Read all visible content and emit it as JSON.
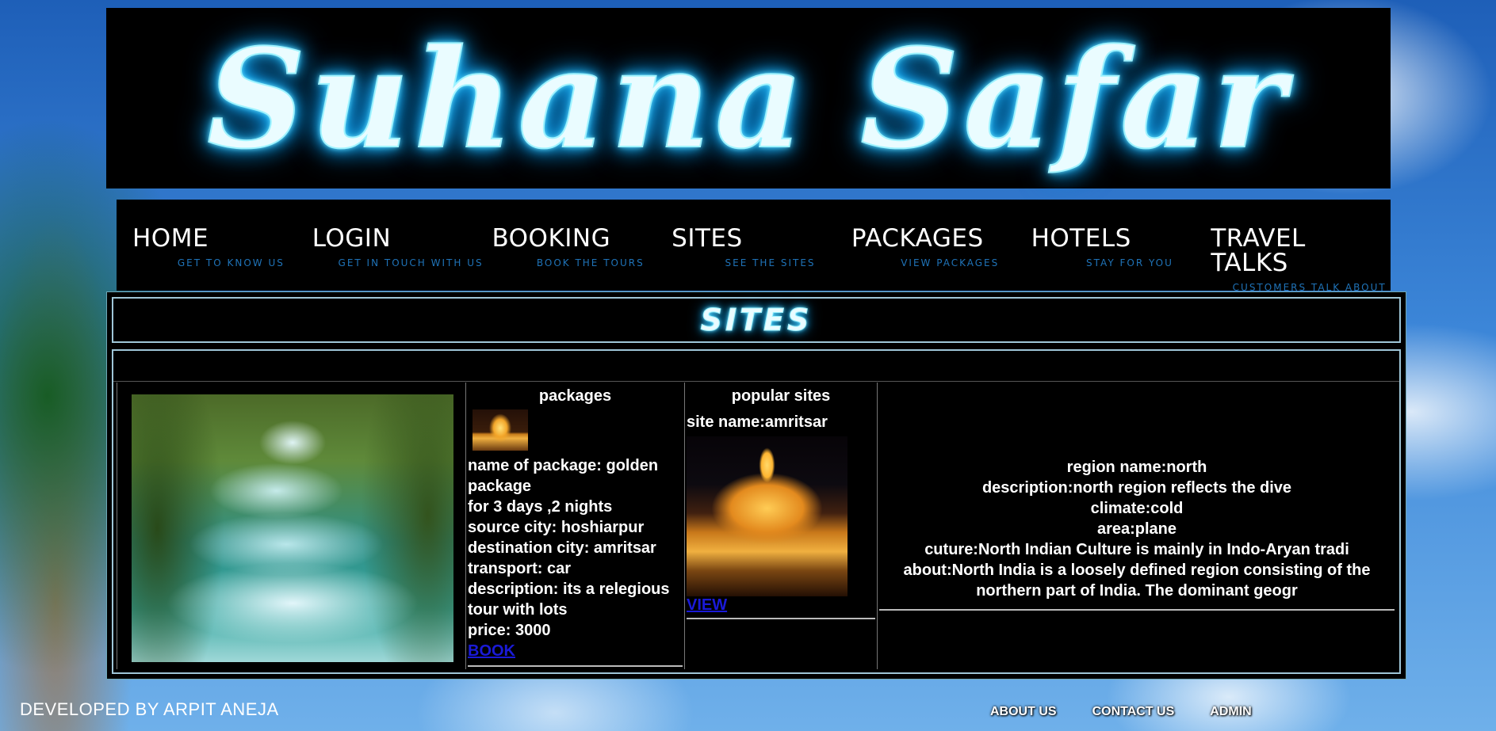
{
  "site_title": "Suhana Safar",
  "nav": [
    {
      "label": "HOME",
      "sub": "GET TO KNOW US"
    },
    {
      "label": "LOGIN",
      "sub": "GET IN TOUCH WITH US"
    },
    {
      "label": "BOOKING",
      "sub": "BOOK THE TOURS"
    },
    {
      "label": "SITES",
      "sub": "SEE THE SITES"
    },
    {
      "label": "PACKAGES",
      "sub": "VIEW PACKAGES"
    },
    {
      "label": "HOTELS",
      "sub": "STAY FOR YOU"
    },
    {
      "label": "TRAVEL TALKS",
      "sub": "CUSTOMERS TALK ABOUT TRAVEL"
    }
  ],
  "page_title": "SITES",
  "packages": {
    "heading": "packages",
    "name_line": "name of package: golden package",
    "duration": "for 3 days ,2 nights",
    "source": "source city: hoshiarpur",
    "destination": "destination city: amritsar",
    "transport": "transport: car",
    "description": "description: its a relegious tour with lots",
    "price": "price: 3000",
    "book_link": "BOOK"
  },
  "popular_sites": {
    "heading": "popular sites",
    "site_name": "site name:amritsar",
    "view_link": "VIEW"
  },
  "region": {
    "name": "region name:north",
    "description": "description:north region reflects the dive",
    "climate": "climate:cold",
    "area": "area:plane",
    "culture": "cuture:North Indian Culture is mainly in Indo-Aryan tradi",
    "about": "about:North India is a loosely defined region consisting of the northern part of India. The dominant geogr"
  },
  "footer": {
    "developer": "DEVELOPED BY ARPIT ANEJA",
    "links": [
      "ABOUT US",
      "CONTACT US",
      "ADMIN"
    ]
  }
}
